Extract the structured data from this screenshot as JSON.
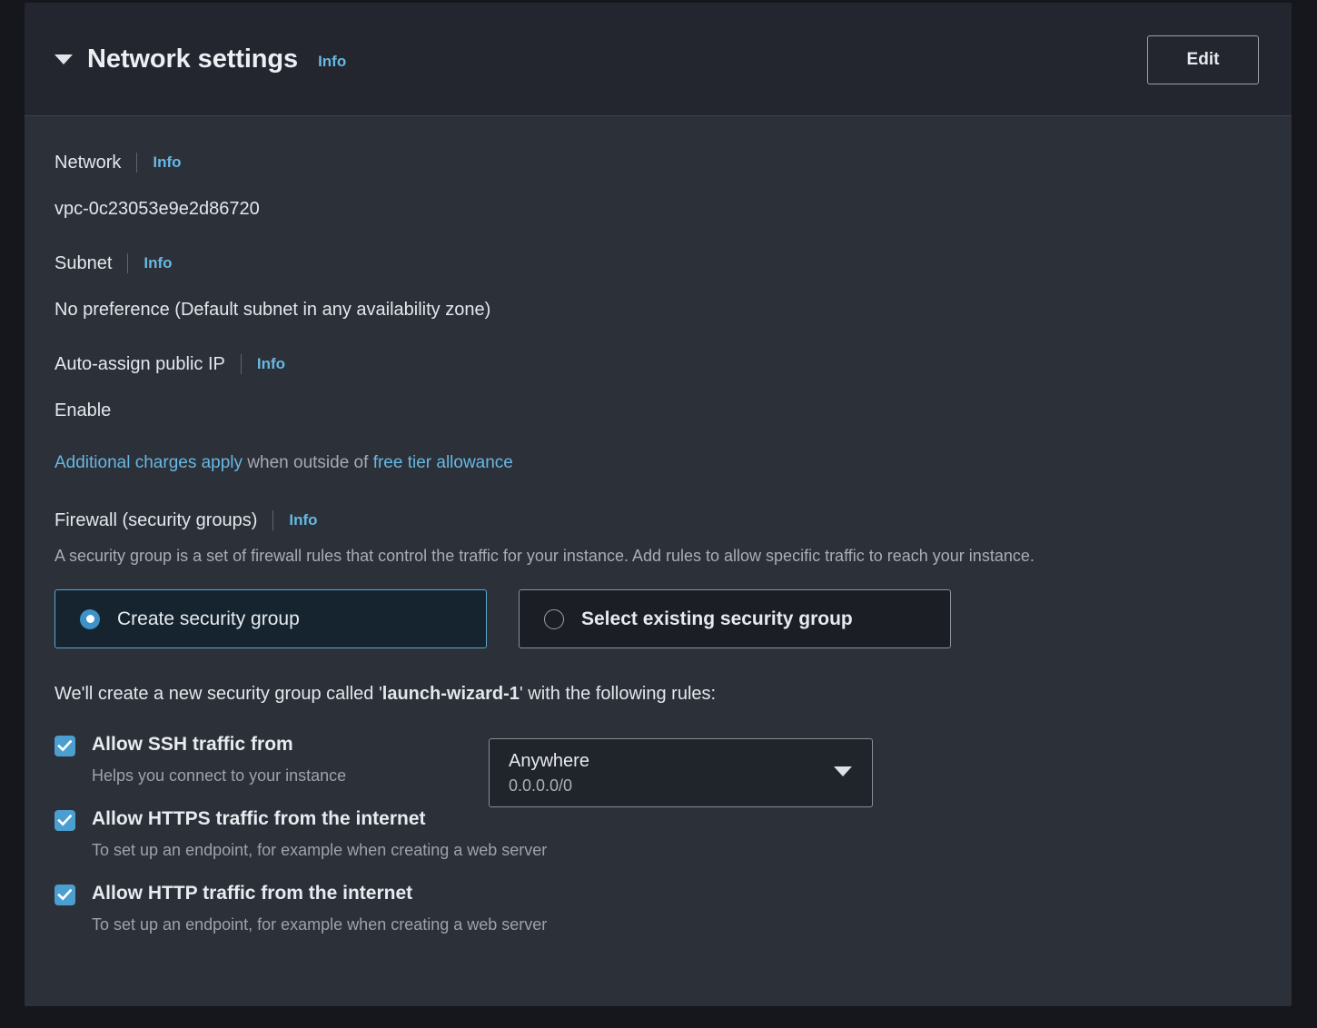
{
  "header": {
    "title": "Network settings",
    "info_label": "Info",
    "edit_label": "Edit",
    "caret_icon": "caret-down-icon"
  },
  "fields": {
    "network": {
      "label": "Network",
      "info_label": "Info",
      "value": "vpc-0c23053e9e2d86720"
    },
    "subnet": {
      "label": "Subnet",
      "info_label": "Info",
      "value": "No preference (Default subnet in any availability zone)"
    },
    "auto_assign_ip": {
      "label": "Auto-assign public IP",
      "info_label": "Info",
      "value": "Enable"
    }
  },
  "charges_note": {
    "link1": "Additional charges apply",
    "middle": " when outside of ",
    "link2": "free tier allowance"
  },
  "firewall": {
    "label": "Firewall (security groups)",
    "info_label": "Info",
    "description": "A security group is a set of firewall rules that control the traffic for your instance. Add rules to allow specific traffic to reach your instance.",
    "options": [
      {
        "label": "Create security group",
        "selected": true,
        "icon": "radio-selected-icon"
      },
      {
        "label": "Select existing security group",
        "selected": false,
        "icon": "radio-unselected-icon"
      }
    ],
    "sentence_prefix": "We'll create a new security group called '",
    "sentence_name": "launch-wizard-1",
    "sentence_suffix": "' with the following rules:",
    "rules": [
      {
        "label": "Allow SSH traffic from",
        "help": "Helps you connect to your instance",
        "checked": true,
        "dropdown": {
          "value": "Anywhere",
          "sub": "0.0.0.0/0",
          "caret_icon": "caret-down-icon"
        }
      },
      {
        "label": "Allow HTTPS traffic from the internet",
        "help": "To set up an endpoint, for example when creating a web server",
        "checked": true
      },
      {
        "label": "Allow HTTP traffic from the internet",
        "help": "To set up an endpoint, for example when creating a web server",
        "checked": true
      }
    ]
  },
  "colors": {
    "accent_blue": "#67b8e3",
    "checkbox_blue": "#4a9fd0",
    "radio_blue": "#3d93c8",
    "selected_tile_bg": "#16242f",
    "panel_bg": "#2c3038",
    "header_bg": "#23262e"
  }
}
